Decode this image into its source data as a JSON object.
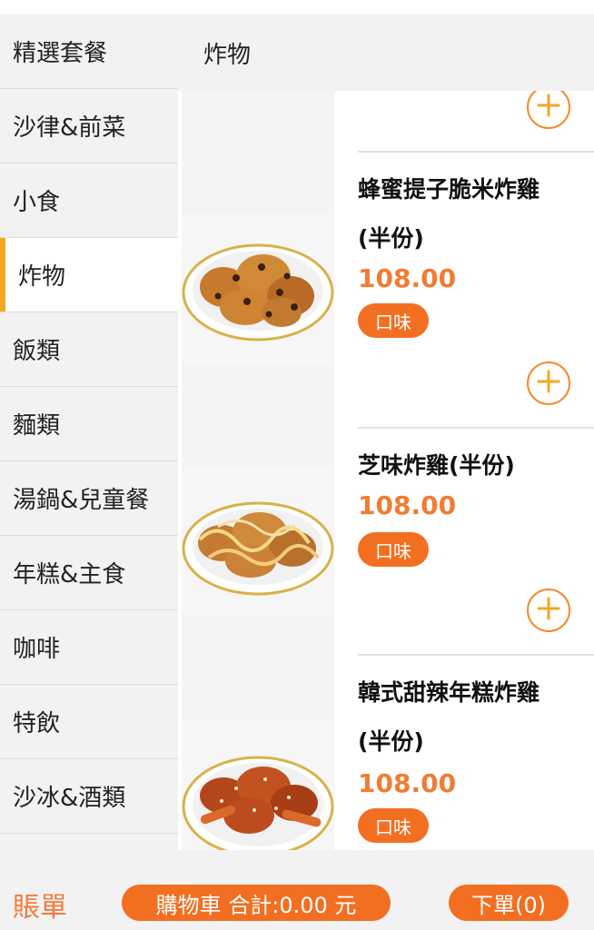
{
  "sidebar": {
    "items": [
      {
        "label": "精選套餐"
      },
      {
        "label": "沙律&前菜"
      },
      {
        "label": "小食"
      },
      {
        "label": "炸物",
        "active": true
      },
      {
        "label": "飯類"
      },
      {
        "label": "麵類"
      },
      {
        "label": "湯鍋&兒童餐"
      },
      {
        "label": "年糕&主食"
      },
      {
        "label": "咖啡"
      },
      {
        "label": "特飲"
      },
      {
        "label": "沙冰&酒類"
      }
    ]
  },
  "header": {
    "title": "炸物"
  },
  "products": [
    {
      "name_line1": "蜂蜜提子脆米炸雞",
      "name_line2": "(半份)",
      "price": "108.00",
      "flavor_label": "口味"
    },
    {
      "name_line1": "芝味炸雞(半份)",
      "name_line2": "",
      "price": "108.00",
      "flavor_label": "口味"
    },
    {
      "name_line1": "韓式甜辣年糕炸雞",
      "name_line2": "(半份)",
      "price": "108.00",
      "flavor_label": "口味"
    }
  ],
  "bottom": {
    "bill_label": "賬單",
    "cart_label": "購物車 合計:0.00 元",
    "order_label": "下單(0)"
  },
  "colors": {
    "accent": "#f26f22",
    "active_indicator": "#f6a623"
  },
  "icons": {
    "add": "plus-circle-icon"
  }
}
